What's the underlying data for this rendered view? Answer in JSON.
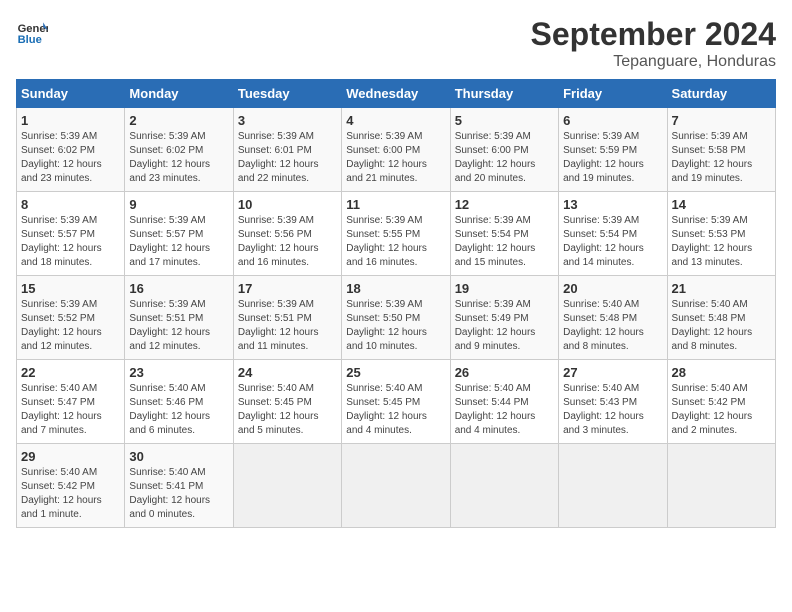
{
  "logo": {
    "line1": "General",
    "line2": "Blue"
  },
  "title": "September 2024",
  "subtitle": "Tepanguare, Honduras",
  "headers": [
    "Sunday",
    "Monday",
    "Tuesday",
    "Wednesday",
    "Thursday",
    "Friday",
    "Saturday"
  ],
  "weeks": [
    [
      {
        "day": "1",
        "info": "Sunrise: 5:39 AM\nSunset: 6:02 PM\nDaylight: 12 hours\nand 23 minutes."
      },
      {
        "day": "2",
        "info": "Sunrise: 5:39 AM\nSunset: 6:02 PM\nDaylight: 12 hours\nand 23 minutes."
      },
      {
        "day": "3",
        "info": "Sunrise: 5:39 AM\nSunset: 6:01 PM\nDaylight: 12 hours\nand 22 minutes."
      },
      {
        "day": "4",
        "info": "Sunrise: 5:39 AM\nSunset: 6:00 PM\nDaylight: 12 hours\nand 21 minutes."
      },
      {
        "day": "5",
        "info": "Sunrise: 5:39 AM\nSunset: 6:00 PM\nDaylight: 12 hours\nand 20 minutes."
      },
      {
        "day": "6",
        "info": "Sunrise: 5:39 AM\nSunset: 5:59 PM\nDaylight: 12 hours\nand 19 minutes."
      },
      {
        "day": "7",
        "info": "Sunrise: 5:39 AM\nSunset: 5:58 PM\nDaylight: 12 hours\nand 19 minutes."
      }
    ],
    [
      {
        "day": "8",
        "info": "Sunrise: 5:39 AM\nSunset: 5:57 PM\nDaylight: 12 hours\nand 18 minutes."
      },
      {
        "day": "9",
        "info": "Sunrise: 5:39 AM\nSunset: 5:57 PM\nDaylight: 12 hours\nand 17 minutes."
      },
      {
        "day": "10",
        "info": "Sunrise: 5:39 AM\nSunset: 5:56 PM\nDaylight: 12 hours\nand 16 minutes."
      },
      {
        "day": "11",
        "info": "Sunrise: 5:39 AM\nSunset: 5:55 PM\nDaylight: 12 hours\nand 16 minutes."
      },
      {
        "day": "12",
        "info": "Sunrise: 5:39 AM\nSunset: 5:54 PM\nDaylight: 12 hours\nand 15 minutes."
      },
      {
        "day": "13",
        "info": "Sunrise: 5:39 AM\nSunset: 5:54 PM\nDaylight: 12 hours\nand 14 minutes."
      },
      {
        "day": "14",
        "info": "Sunrise: 5:39 AM\nSunset: 5:53 PM\nDaylight: 12 hours\nand 13 minutes."
      }
    ],
    [
      {
        "day": "15",
        "info": "Sunrise: 5:39 AM\nSunset: 5:52 PM\nDaylight: 12 hours\nand 12 minutes."
      },
      {
        "day": "16",
        "info": "Sunrise: 5:39 AM\nSunset: 5:51 PM\nDaylight: 12 hours\nand 12 minutes."
      },
      {
        "day": "17",
        "info": "Sunrise: 5:39 AM\nSunset: 5:51 PM\nDaylight: 12 hours\nand 11 minutes."
      },
      {
        "day": "18",
        "info": "Sunrise: 5:39 AM\nSunset: 5:50 PM\nDaylight: 12 hours\nand 10 minutes."
      },
      {
        "day": "19",
        "info": "Sunrise: 5:39 AM\nSunset: 5:49 PM\nDaylight: 12 hours\nand 9 minutes."
      },
      {
        "day": "20",
        "info": "Sunrise: 5:40 AM\nSunset: 5:48 PM\nDaylight: 12 hours\nand 8 minutes."
      },
      {
        "day": "21",
        "info": "Sunrise: 5:40 AM\nSunset: 5:48 PM\nDaylight: 12 hours\nand 8 minutes."
      }
    ],
    [
      {
        "day": "22",
        "info": "Sunrise: 5:40 AM\nSunset: 5:47 PM\nDaylight: 12 hours\nand 7 minutes."
      },
      {
        "day": "23",
        "info": "Sunrise: 5:40 AM\nSunset: 5:46 PM\nDaylight: 12 hours\nand 6 minutes."
      },
      {
        "day": "24",
        "info": "Sunrise: 5:40 AM\nSunset: 5:45 PM\nDaylight: 12 hours\nand 5 minutes."
      },
      {
        "day": "25",
        "info": "Sunrise: 5:40 AM\nSunset: 5:45 PM\nDaylight: 12 hours\nand 4 minutes."
      },
      {
        "day": "26",
        "info": "Sunrise: 5:40 AM\nSunset: 5:44 PM\nDaylight: 12 hours\nand 4 minutes."
      },
      {
        "day": "27",
        "info": "Sunrise: 5:40 AM\nSunset: 5:43 PM\nDaylight: 12 hours\nand 3 minutes."
      },
      {
        "day": "28",
        "info": "Sunrise: 5:40 AM\nSunset: 5:42 PM\nDaylight: 12 hours\nand 2 minutes."
      }
    ],
    [
      {
        "day": "29",
        "info": "Sunrise: 5:40 AM\nSunset: 5:42 PM\nDaylight: 12 hours\nand 1 minute."
      },
      {
        "day": "30",
        "info": "Sunrise: 5:40 AM\nSunset: 5:41 PM\nDaylight: 12 hours\nand 0 minutes."
      },
      {
        "day": "",
        "info": ""
      },
      {
        "day": "",
        "info": ""
      },
      {
        "day": "",
        "info": ""
      },
      {
        "day": "",
        "info": ""
      },
      {
        "day": "",
        "info": ""
      }
    ]
  ]
}
